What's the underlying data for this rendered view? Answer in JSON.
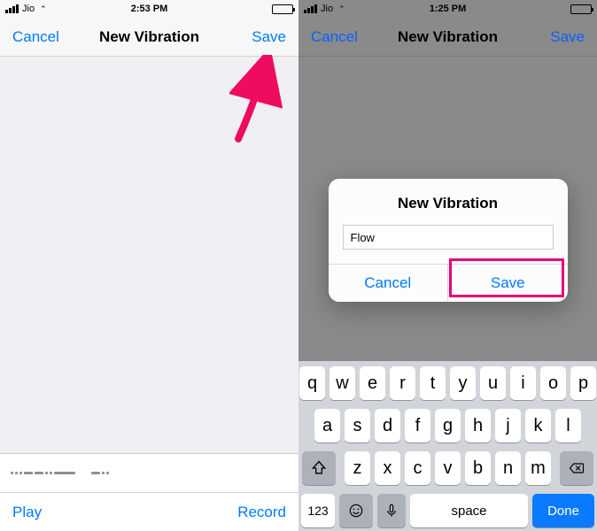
{
  "left": {
    "status": {
      "carrier": "Jio",
      "time": "2:53 PM"
    },
    "nav": {
      "cancel": "Cancel",
      "title": "New Vibration",
      "save": "Save"
    },
    "toolbar": {
      "play": "Play",
      "record": "Record"
    }
  },
  "right": {
    "status": {
      "carrier": "Jio",
      "time": "1:25 PM"
    },
    "nav": {
      "cancel": "Cancel",
      "title": "New Vibration",
      "save": "Save"
    },
    "dialog": {
      "title": "New Vibration",
      "input_value": "Flow",
      "cancel": "Cancel",
      "save": "Save"
    },
    "keyboard": {
      "row1": [
        "q",
        "w",
        "e",
        "r",
        "t",
        "y",
        "u",
        "i",
        "o",
        "p"
      ],
      "row2": [
        "a",
        "s",
        "d",
        "f",
        "g",
        "h",
        "j",
        "k",
        "l"
      ],
      "row3": [
        "z",
        "x",
        "c",
        "v",
        "b",
        "n",
        "m"
      ],
      "numkey": "123",
      "space": "space",
      "done": "Done"
    }
  }
}
